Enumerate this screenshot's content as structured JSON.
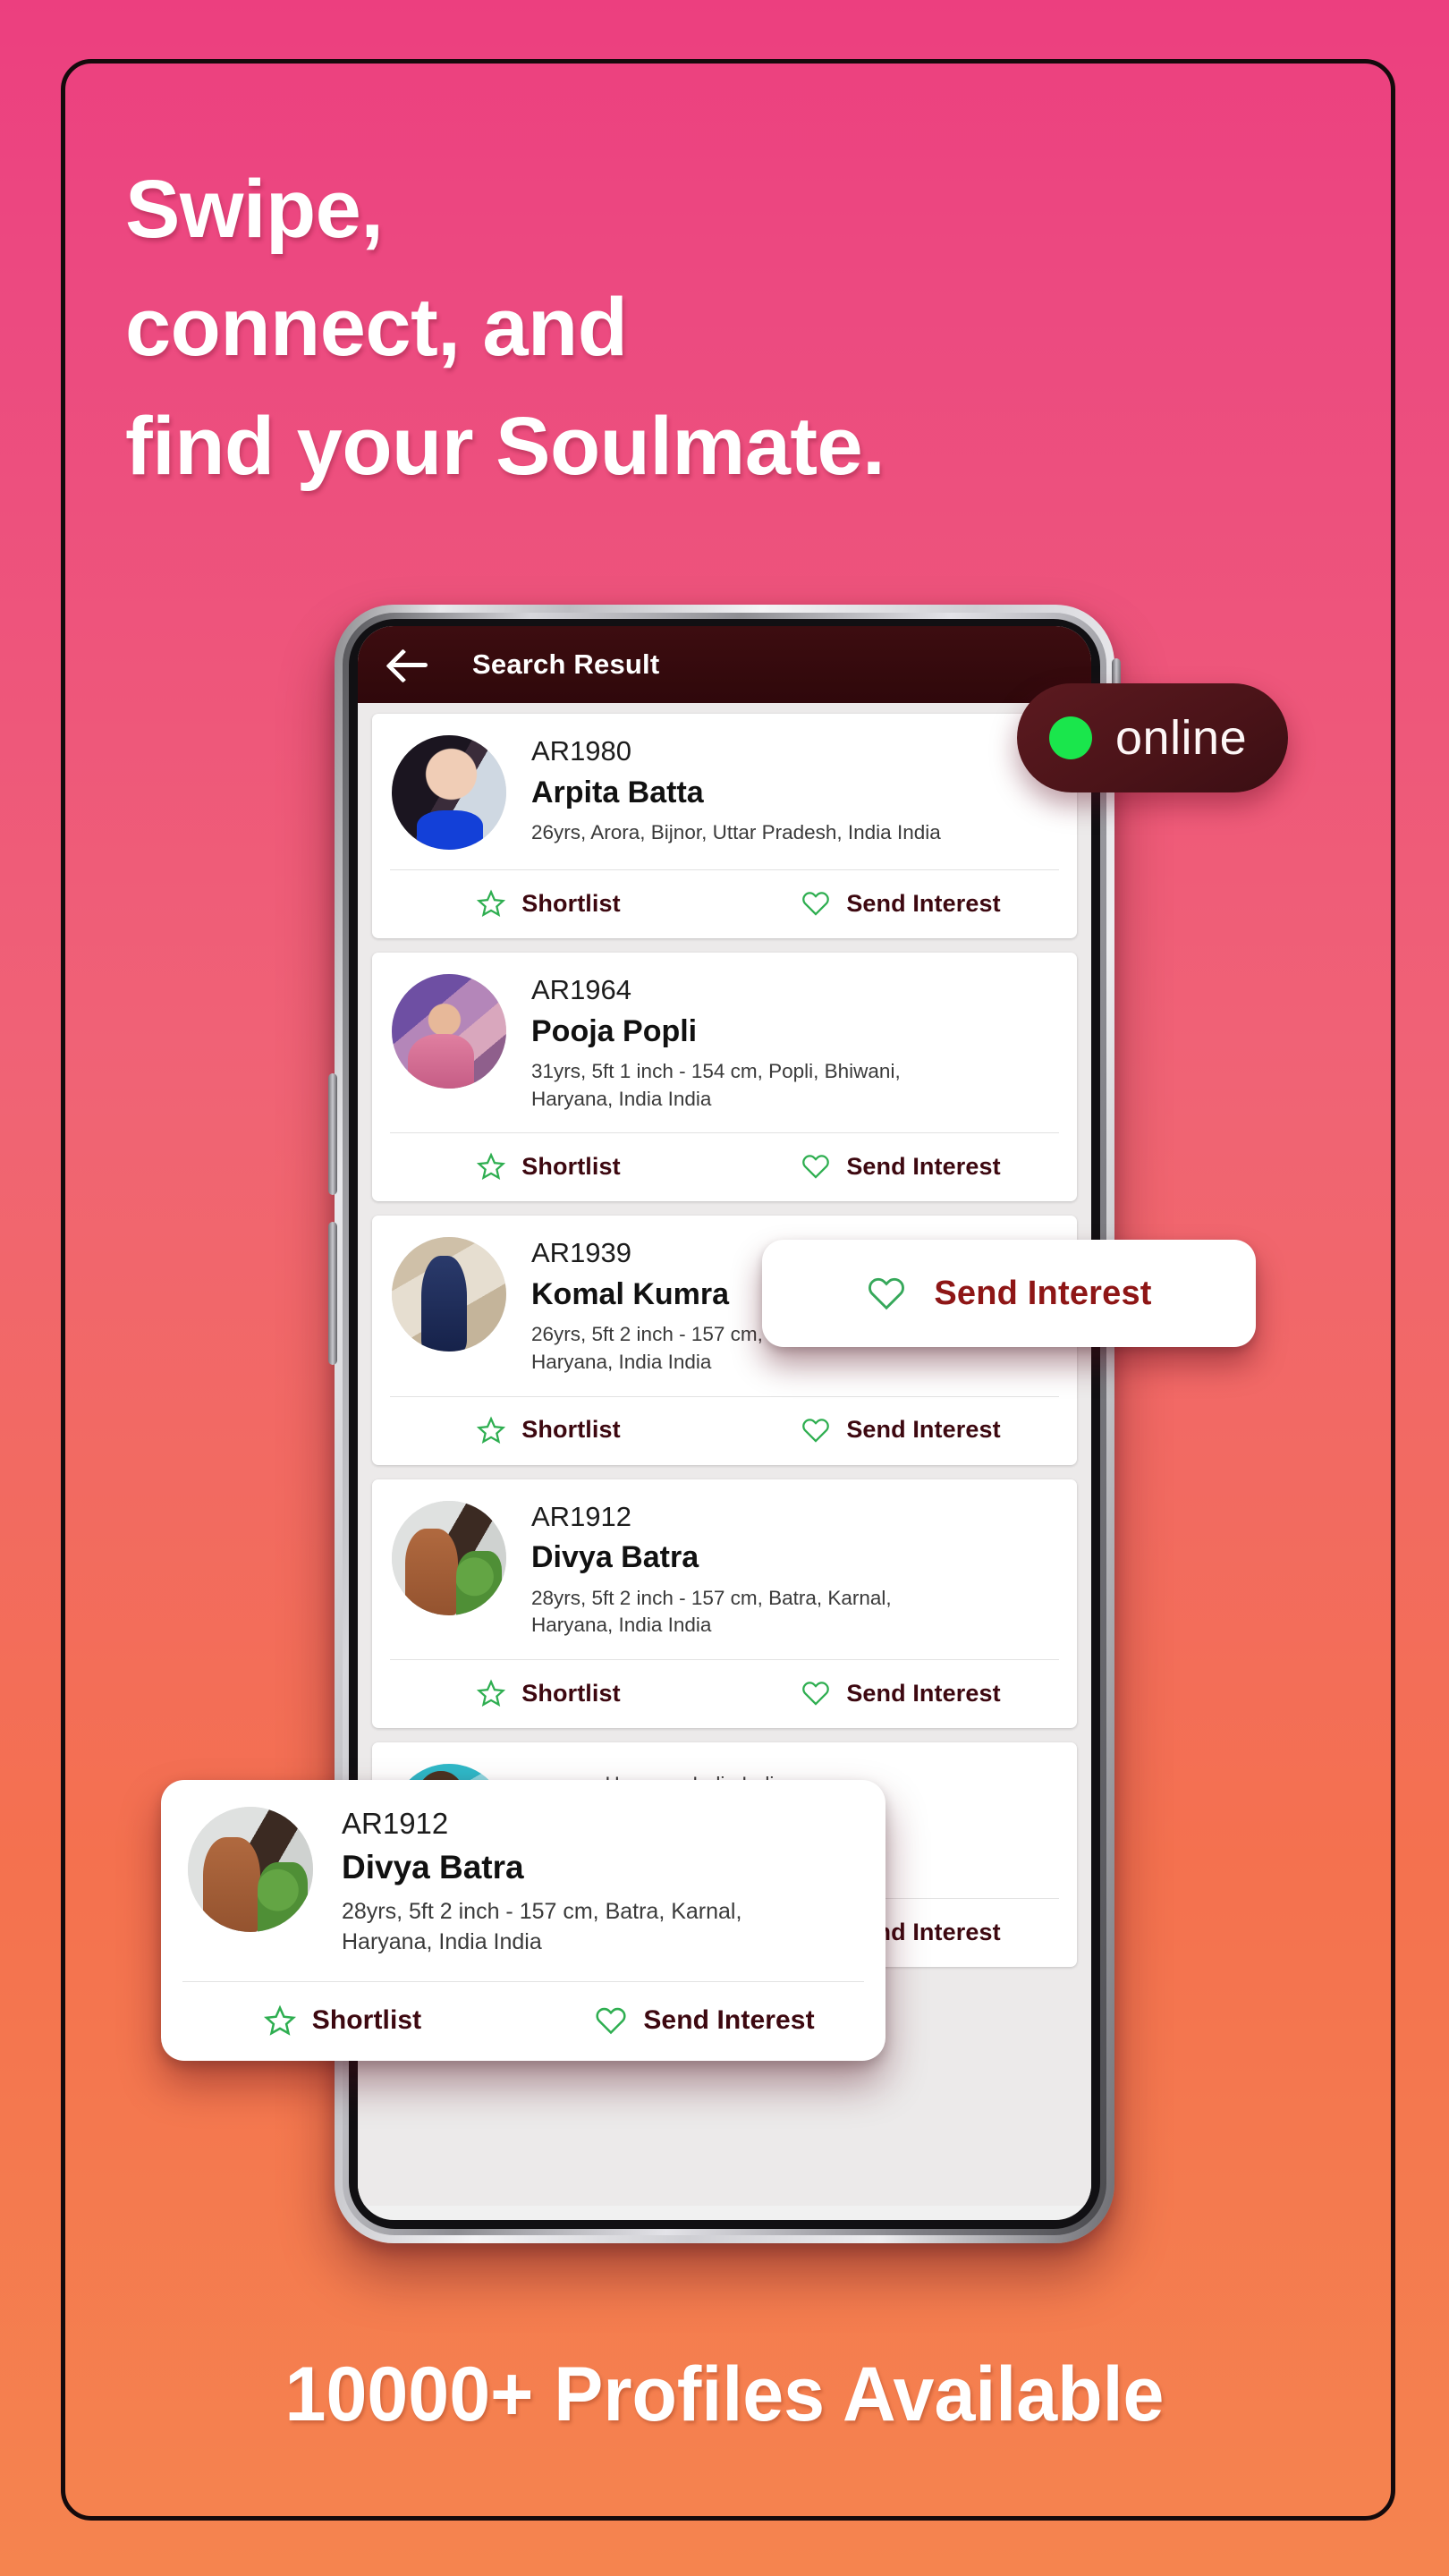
{
  "poster": {
    "headline_lines": [
      "Swipe,",
      "connect, and",
      "find your Soulmate."
    ],
    "tagline": "10000+ Profiles Available",
    "gradient_top": "#ec4a80",
    "gradient_bottom": "#f5844f"
  },
  "online_badge": {
    "label": "online",
    "dot_color": "#1ae64c",
    "background": "#4a1318"
  },
  "app": {
    "appbar": {
      "back_icon": "back-arrow-icon",
      "title": "Search Result"
    },
    "action_labels": {
      "shortlist": "Shortlist",
      "send_interest": "Send Interest"
    },
    "icons": {
      "shortlist": "star-outline-icon",
      "send_interest": "heart-outline-icon"
    },
    "colors": {
      "appbar_bg": "#2f080b",
      "action_text": "#3d0810",
      "icon_green": "#2eae50"
    },
    "profiles": [
      {
        "id": "AR1980",
        "name": "Arpita Batta",
        "details": "26yrs,  Arora, Bijnor, Uttar Pradesh, India India",
        "photo": "p1"
      },
      {
        "id": "AR1964",
        "name": "Pooja Popli",
        "details": "31yrs, 5ft 1 inch - 154 cm, Popli, Bhiwani, Haryana, India India",
        "photo": "p2"
      },
      {
        "id": "AR1939",
        "name": "Komal Kumra",
        "details": "26yrs, 5ft 2 inch - 157 cm, Kumra, Panchkula, Haryana, India India",
        "photo": "p3"
      },
      {
        "id": "AR1912",
        "name": "Divya Batra",
        "details": "28yrs, 5ft 2 inch - 157 cm, Batra, Karnal, Haryana, India India",
        "photo": "p4"
      },
      {
        "id": "",
        "name": "",
        "details": "urgaon, Haryana, India India",
        "photo": "p5"
      }
    ]
  },
  "float_pill": {
    "label": "Send Interest",
    "icon": "heart-outline-icon",
    "text_color": "#8e1616"
  },
  "float_card": {
    "id": "AR1912",
    "name": "Divya Batra",
    "details": "28yrs, 5ft 2 inch - 157 cm, Batra, Karnal, Haryana, India India",
    "shortlist": "Shortlist",
    "send_interest": "Send Interest",
    "photo": "p4"
  }
}
